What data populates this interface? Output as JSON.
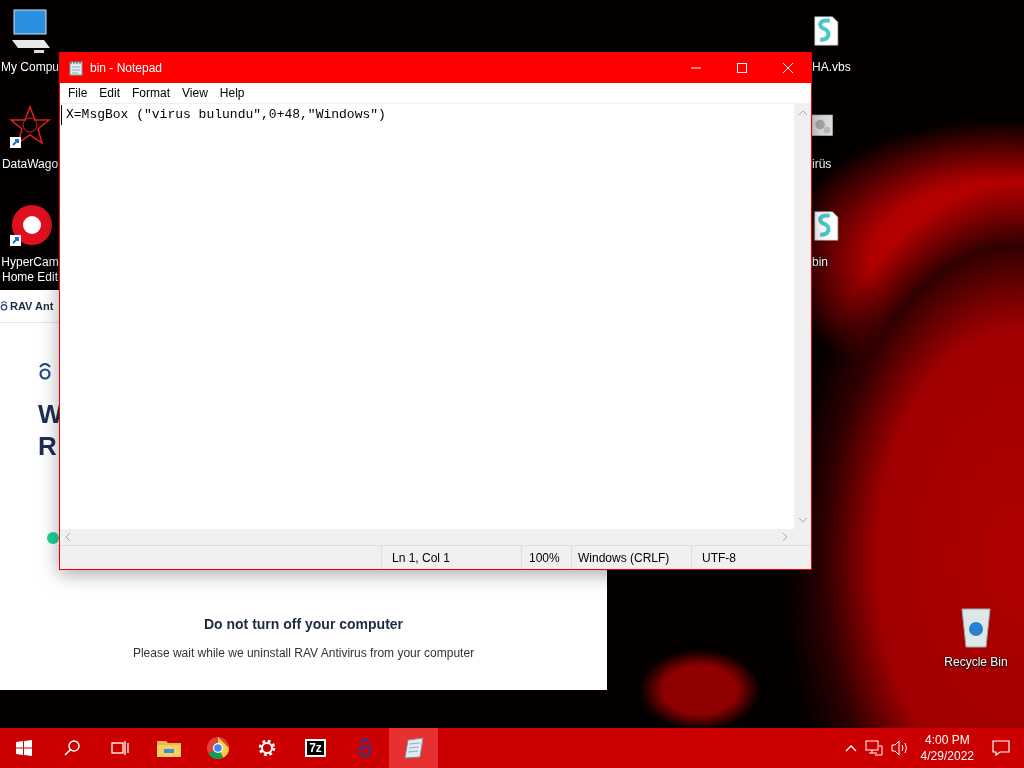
{
  "desktop_icons": [
    {
      "label": "My Compu",
      "kind": "computer"
    },
    {
      "label": "DataWago",
      "kind": "star"
    },
    {
      "label": "HyperCam Home Edit",
      "kind": "camera"
    },
    {
      "label": "HA.vbs",
      "kind": "script"
    },
    {
      "label": "irüs",
      "kind": "gears"
    },
    {
      "label": "bin",
      "kind": "script"
    }
  ],
  "recycle_bin": {
    "label": "Recycle Bin"
  },
  "rav_window": {
    "title": "RAV Ant",
    "heading_lines": [
      "W",
      "R"
    ],
    "warning": "Do not turn off your computer",
    "message": "Please wait while we uninstall RAV Antivirus from your computer"
  },
  "notepad": {
    "title": "bin - Notepad",
    "menu": [
      "File",
      "Edit",
      "Format",
      "View",
      "Help"
    ],
    "content": "X=MsgBox (\"virus bulundu\",0+48,\"Windows\")",
    "status": {
      "position": "Ln 1, Col 1",
      "zoom": "100%",
      "line_endings": "Windows (CRLF)",
      "encoding": "UTF-8"
    }
  },
  "taskbar": {
    "apps": [
      {
        "kind": "folder",
        "selected": false
      },
      {
        "kind": "chrome",
        "selected": false
      },
      {
        "kind": "gear",
        "selected": false
      },
      {
        "kind": "archive",
        "label": "7z",
        "selected": false
      },
      {
        "kind": "rav",
        "selected": false
      },
      {
        "kind": "notepad",
        "selected": true
      }
    ],
    "time": "4:00 PM",
    "date": "4/29/2022"
  }
}
